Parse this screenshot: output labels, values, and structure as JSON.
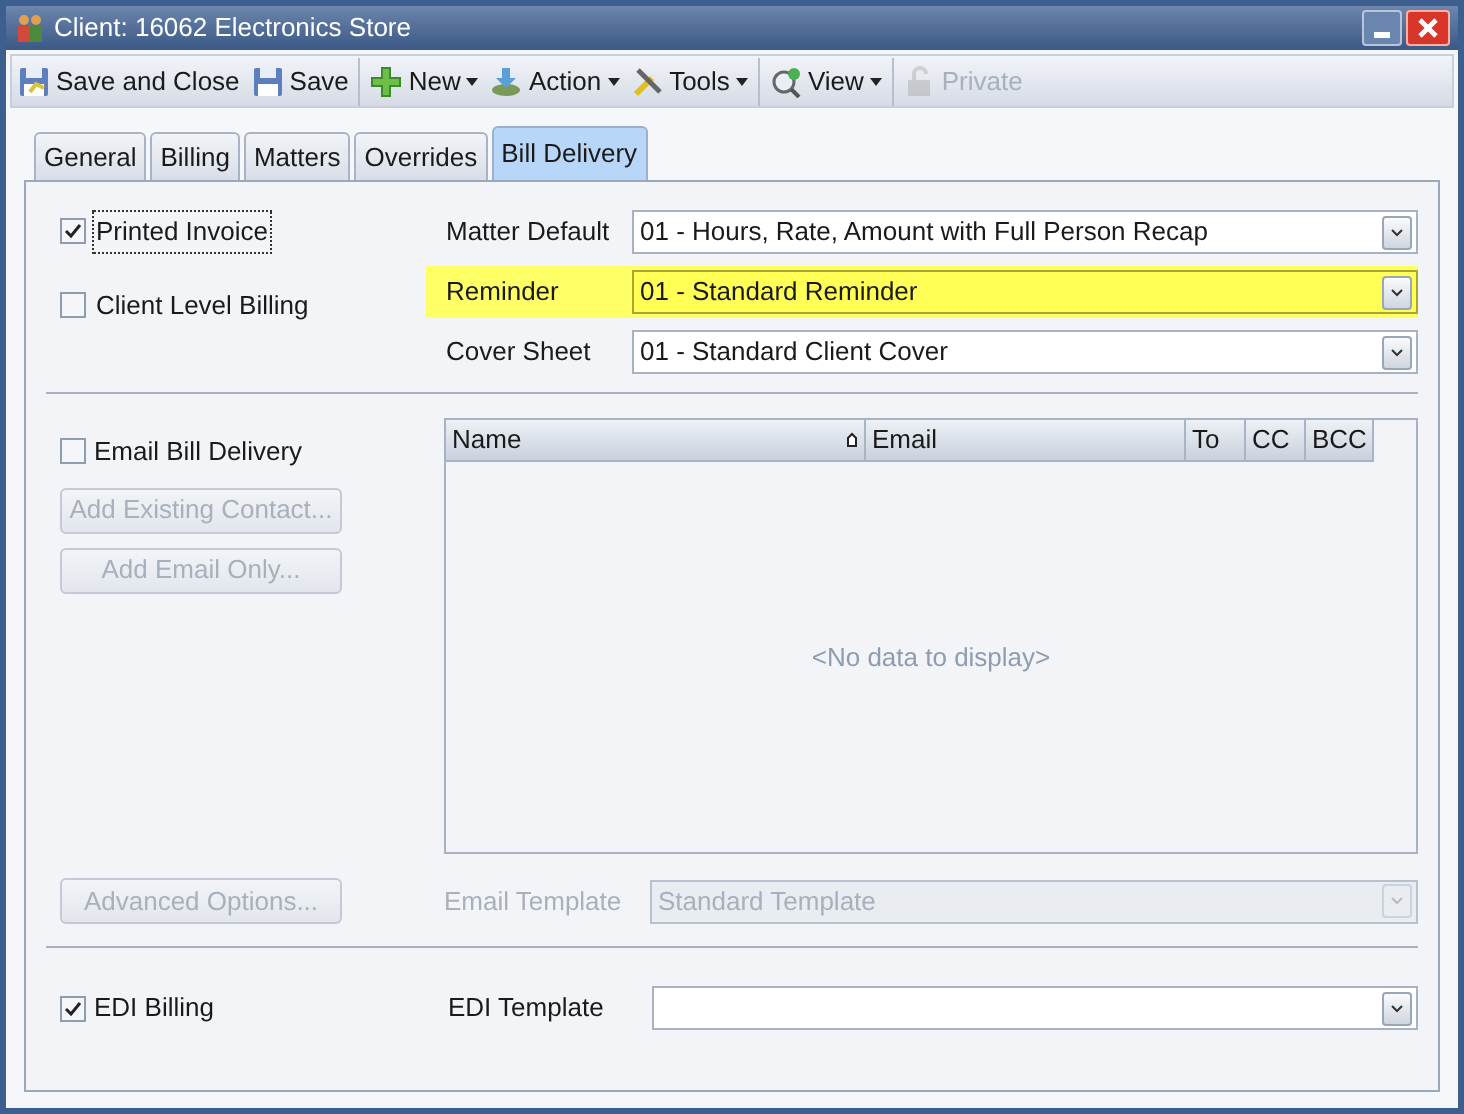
{
  "window": {
    "title": "Client: 16062 Electronics Store"
  },
  "toolbar": [
    {
      "label": "Save and Close",
      "kind": "save-close",
      "menu": false,
      "disabled": false,
      "separator_after": false
    },
    {
      "label": "Save",
      "kind": "save",
      "menu": false,
      "disabled": false,
      "separator_after": true
    },
    {
      "label": "New",
      "kind": "new",
      "menu": true,
      "disabled": false,
      "separator_after": false
    },
    {
      "label": "Action",
      "kind": "action",
      "menu": true,
      "disabled": false,
      "separator_after": false
    },
    {
      "label": "Tools",
      "kind": "tools",
      "menu": true,
      "disabled": false,
      "separator_after": true
    },
    {
      "label": "View",
      "kind": "view",
      "menu": true,
      "disabled": false,
      "separator_after": true
    },
    {
      "label": "Private",
      "kind": "lock",
      "menu": false,
      "disabled": true,
      "separator_after": false
    }
  ],
  "tabs": [
    {
      "label": "General",
      "selected": false
    },
    {
      "label": "Billing",
      "selected": false
    },
    {
      "label": "Matters",
      "selected": false
    },
    {
      "label": "Overrides",
      "selected": false
    },
    {
      "label": "Bill Delivery",
      "selected": true
    }
  ],
  "options": [
    {
      "label": "Printed Invoice",
      "checked": true,
      "focused": true
    },
    {
      "label": "Client Level Billing",
      "checked": false,
      "focused": false
    }
  ],
  "dropdowns": [
    {
      "label": "Matter Default",
      "value": "01 - Hours, Rate, Amount with Full Person Recap",
      "highlighted": false
    },
    {
      "label": "Reminder",
      "value": "01 - Standard Reminder",
      "highlighted": true
    },
    {
      "label": "Cover Sheet",
      "value": "01 - Standard Client Cover",
      "highlighted": false
    }
  ],
  "email": {
    "checkbox": {
      "label": "Email Bill Delivery",
      "checked": false
    },
    "buttons": [
      {
        "label": "Add Existing Contact...",
        "disabled": true
      },
      {
        "label": "Add Email Only...",
        "disabled": true
      }
    ],
    "grid": {
      "columns": [
        {
          "label": "Name",
          "sorted": true
        },
        {
          "label": "Email",
          "sorted": false
        },
        {
          "label": "To",
          "sorted": false
        },
        {
          "label": "CC",
          "sorted": false
        },
        {
          "label": "BCC",
          "sorted": false
        }
      ],
      "empty_text": "<No data to display>"
    },
    "advanced_button": {
      "label": "Advanced Options...",
      "disabled": true
    },
    "template": {
      "label": "Email Template",
      "value": "Standard Template",
      "disabled": true
    }
  },
  "edi": {
    "checkbox": {
      "label": "EDI Billing",
      "checked": true
    },
    "template": {
      "label": "EDI Template"
    }
  }
}
